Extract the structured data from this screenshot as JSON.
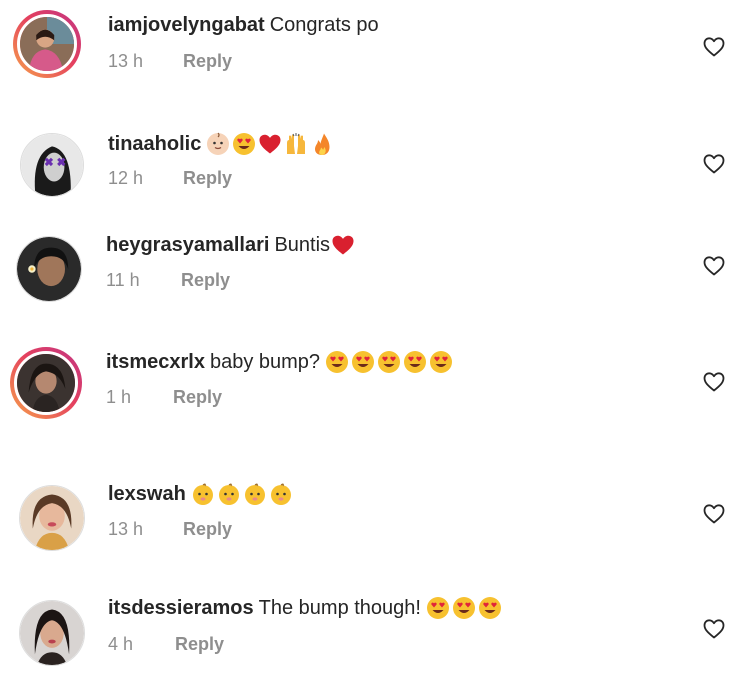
{
  "reply_label": "Reply",
  "comments": [
    {
      "username": "iamjovelyngabat",
      "text": "Congrats po",
      "time": "13 h",
      "emojis": [],
      "story_ring": true
    },
    {
      "username": "tinaaholic",
      "text": "",
      "time": "12 h",
      "emojis": [
        "baby-face-emoji",
        "heart-eyes-emoji",
        "red-heart-emoji",
        "raising-hands-emoji",
        "fire-emoji"
      ],
      "story_ring": false
    },
    {
      "username": "heygrasyamallari",
      "text": "Buntis",
      "time": "11 h",
      "emojis": [
        "red-heart-emoji"
      ],
      "story_ring": false
    },
    {
      "username": "itsmecxrlx",
      "text": "baby bump?",
      "time": "1 h",
      "emojis": [
        "heart-eyes-emoji",
        "heart-eyes-emoji",
        "heart-eyes-emoji",
        "heart-eyes-emoji",
        "heart-eyes-emoji"
      ],
      "story_ring": true
    },
    {
      "username": "lexswah",
      "text": "",
      "time": "13 h",
      "emojis": [
        "baby-emoji",
        "baby-emoji",
        "baby-emoji",
        "baby-emoji"
      ],
      "story_ring": false
    },
    {
      "username": "itsdessieramos",
      "text": "The bump though!",
      "time": "4 h",
      "emojis": [
        "heart-eyes-emoji",
        "heart-eyes-emoji",
        "heart-eyes-emoji"
      ],
      "story_ring": false
    }
  ],
  "colors": {
    "text": "#262626",
    "secondary": "#8e8e8e",
    "story_gradient_start": "#f7a34b",
    "story_gradient_end": "#c13584"
  }
}
